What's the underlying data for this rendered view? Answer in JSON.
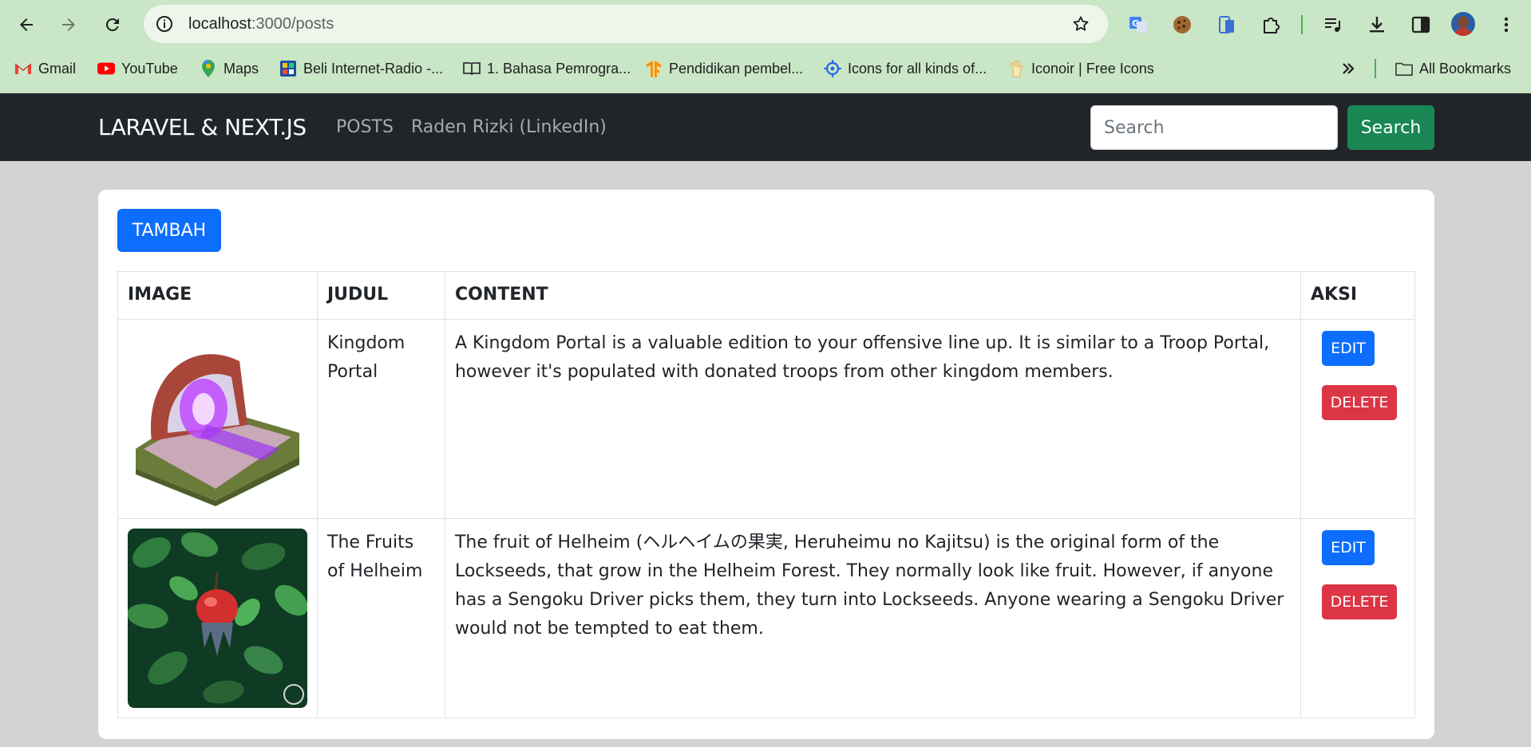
{
  "browser": {
    "url_host": "localhost",
    "url_path": ":3000/posts",
    "bookmarks": [
      {
        "label": "Gmail",
        "icon": "gmail-icon"
      },
      {
        "label": "YouTube",
        "icon": "youtube-icon"
      },
      {
        "label": "Maps",
        "icon": "maps-icon"
      },
      {
        "label": "Beli Internet-Radio -...",
        "icon": "radio-icon"
      },
      {
        "label": "1. Bahasa Pemrogra...",
        "icon": "book-icon"
      },
      {
        "label": "Pendidikan pembel...",
        "icon": "tensorflow-icon"
      },
      {
        "label": "Icons for all kinds of...",
        "icon": "icons-site-icon"
      },
      {
        "label": "Iconoir | Free Icons",
        "icon": "iconoir-icon"
      }
    ],
    "all_bookmarks": "All Bookmarks"
  },
  "navbar": {
    "brand": "LARAVEL & NEXT.JS",
    "links": [
      "POSTS",
      "Raden Rizki (LinkedIn)"
    ],
    "search_placeholder": "Search",
    "search_button": "Search"
  },
  "main": {
    "add_button": "TAMBAH",
    "columns": [
      "IMAGE",
      "JUDUL",
      "CONTENT",
      "AKSI"
    ],
    "rows": [
      {
        "title": "Kingdom Portal",
        "content": "A Kingdom Portal is a valuable edition to your offensive line up. It is similar to a Troop Portal, however it's populated with donated troops from other kingdom members.",
        "edit": "EDIT",
        "delete": "DELETE"
      },
      {
        "title": "The Fruits of Helheim",
        "content": "The fruit of Helheim (ヘルヘイムの果実, Heruheimu no Kajitsu) is the original form of the Lockseeds, that grow in the Helheim Forest. They normally look like fruit. However, if anyone has a Sengoku Driver picks them, they turn into Lockseeds. Anyone wearing a Sengoku Driver would not be tempted to eat them.",
        "edit": "EDIT",
        "delete": "DELETE"
      }
    ]
  },
  "colors": {
    "chrome": "#c9e6c7",
    "navbar": "#212529",
    "primary": "#0d6efd",
    "success": "#198754",
    "danger": "#dc3545"
  }
}
